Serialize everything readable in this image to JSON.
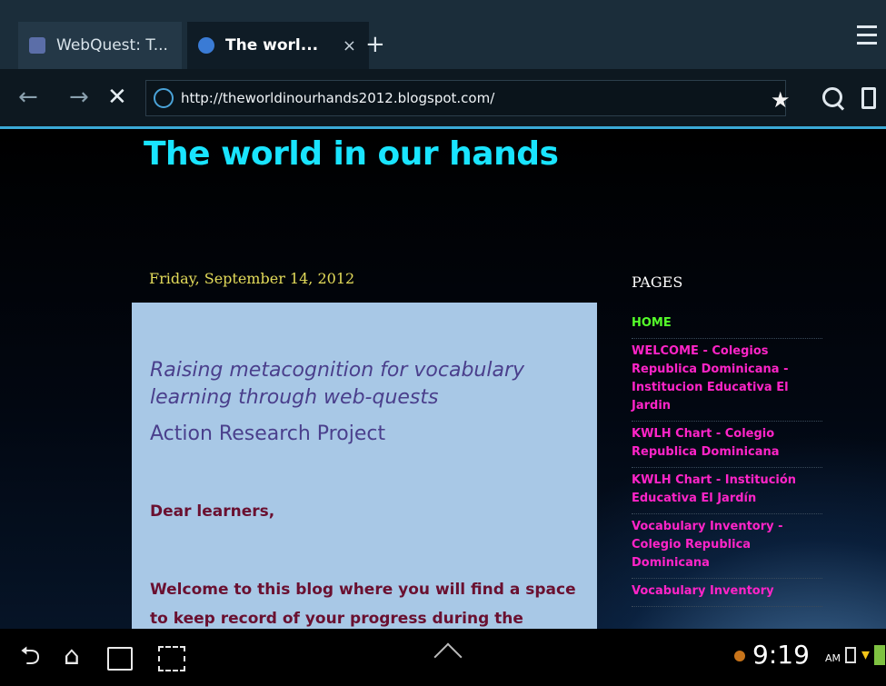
{
  "tabs": [
    {
      "label": "WebQuest: T...",
      "favicon": "webquest-favicon-icon"
    },
    {
      "label": "The worl...",
      "favicon": "blogger-favicon-icon",
      "close": "×",
      "active": true
    }
  ],
  "new_tab_label": "+",
  "toolbar": {
    "back": "←",
    "forward": "→",
    "stop": "✕",
    "url": "http://theworldinourhands2012.blogspot.com/",
    "star": "★"
  },
  "page": {
    "blog_title": "The world in our hands",
    "post_date": "Friday, September 14, 2012",
    "post": {
      "title": "Raising metacognition for vocabulary learning through web-quests",
      "subtitle": "Action Research Project",
      "greeting": "Dear learners,",
      "body": "Welcome to this blog where you will find a space to keep record of your progress during the development"
    },
    "sidebar": {
      "heading": "PAGES",
      "links": [
        "HOME",
        "WELCOME - Colegios Republica Dominicana - Institucion Educativa El Jardin",
        "KWLH Chart - Colegio Republica Dominicana",
        "KWLH Chart - Institución Educativa El Jardín",
        "Vocabulary Inventory - Colegio Republica Dominicana",
        "Vocabulary Inventory"
      ]
    }
  },
  "status_bar": {
    "time": "9:19",
    "ampm": "AM"
  },
  "colors": {
    "title": "#19e4ff",
    "date": "#e4dc5a",
    "post_bg": "#a8c8e6",
    "home_link": "#55ff2a",
    "page_link": "#ff24c8"
  }
}
